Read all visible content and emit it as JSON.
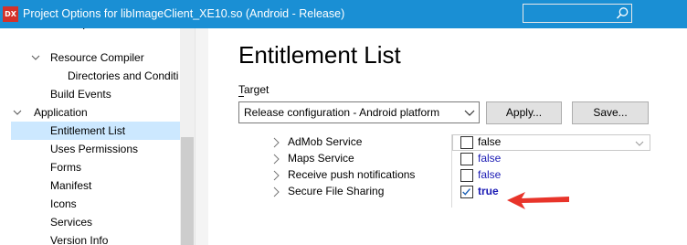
{
  "window": {
    "title": "Project Options for libImageClient_XE10.so  (Android - Release)",
    "app_icon_text": "DX",
    "search_value": ""
  },
  "tree": {
    "items": [
      {
        "label": "Resource Compiler"
      },
      {
        "label": "Directories and Conditi"
      },
      {
        "label": "Build Events"
      },
      {
        "label": "Application"
      },
      {
        "label": "Entitlement List"
      },
      {
        "label": "Uses Permissions"
      },
      {
        "label": "Forms"
      },
      {
        "label": "Manifest"
      },
      {
        "label": "Icons"
      },
      {
        "label": "Services"
      },
      {
        "label": "Version Info"
      }
    ]
  },
  "main": {
    "heading": "Entitlement List",
    "target_label": "Target",
    "target_value": "Release configuration - Android platform",
    "apply_label": "Apply...",
    "save_label": "Save..."
  },
  "entitlements": [
    {
      "name": "AdMob Service",
      "value": "false",
      "checked": false
    },
    {
      "name": "Maps Service",
      "value": "false",
      "checked": false
    },
    {
      "name": "Receive push notifications",
      "value": "false",
      "checked": false
    },
    {
      "name": "Secure File Sharing",
      "value": "true",
      "checked": true
    }
  ],
  "colors": {
    "titlebar": "#1a8fd4",
    "selection": "#cce8ff",
    "value_text": "#1a1ab4",
    "annotation_arrow": "#e8342a"
  }
}
